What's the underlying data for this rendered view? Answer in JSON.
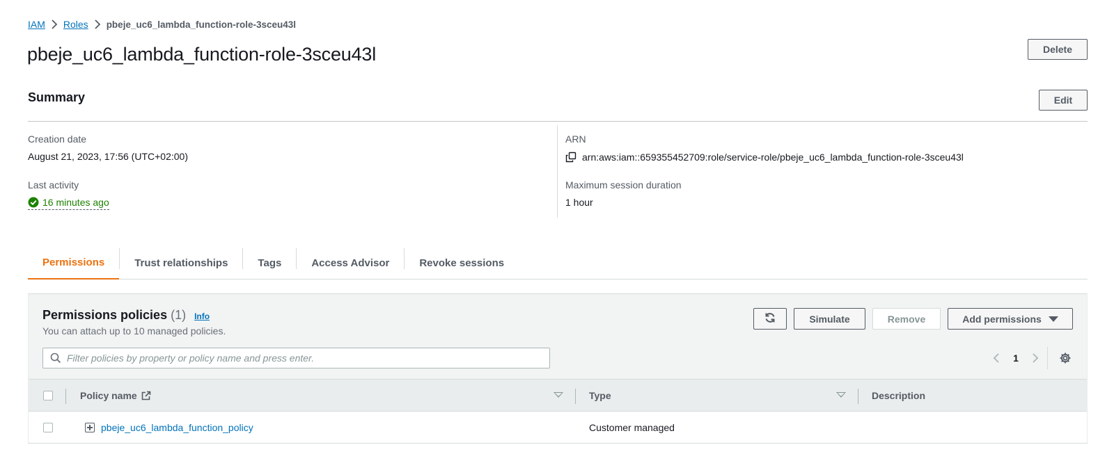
{
  "breadcrumb": {
    "items": [
      {
        "label": "IAM"
      },
      {
        "label": "Roles"
      }
    ],
    "current": "pbeje_uc6_lambda_function-role-3sceu43l"
  },
  "page": {
    "title": "pbeje_uc6_lambda_function-role-3sceu43l",
    "delete_label": "Delete"
  },
  "summary": {
    "title": "Summary",
    "edit_label": "Edit",
    "creation_date_label": "Creation date",
    "creation_date_value": "August 21, 2023, 17:56 (UTC+02:00)",
    "last_activity_label": "Last activity",
    "last_activity_value": "16 minutes ago",
    "arn_label": "ARN",
    "arn_value": "arn:aws:iam::659355452709:role/service-role/pbeje_uc6_lambda_function-role-3sceu43l",
    "max_session_label": "Maximum session duration",
    "max_session_value": "1 hour"
  },
  "tabs": [
    {
      "label": "Permissions",
      "active": true
    },
    {
      "label": "Trust relationships",
      "active": false
    },
    {
      "label": "Tags",
      "active": false
    },
    {
      "label": "Access Advisor",
      "active": false
    },
    {
      "label": "Revoke sessions",
      "active": false
    }
  ],
  "policies": {
    "title": "Permissions policies",
    "count": "(1)",
    "info_label": "Info",
    "subtitle": "You can attach up to 10 managed policies.",
    "simulate_label": "Simulate",
    "remove_label": "Remove",
    "add_permissions_label": "Add permissions",
    "filter_placeholder": "Filter policies by property or policy name and press enter.",
    "page_number": "1",
    "columns": [
      "Policy name",
      "Type",
      "Description"
    ],
    "rows": [
      {
        "name": "pbeje_uc6_lambda_function_policy",
        "type": "Customer managed",
        "description": ""
      }
    ]
  },
  "colors": {
    "link": "#0073bb",
    "accent_tab": "#ec7211",
    "success": "#1d8102"
  },
  "icons": [
    "chevron-right-icon",
    "check-circle-icon",
    "copy-icon",
    "refresh-icon",
    "caret-down-icon",
    "search-icon",
    "chevron-left-icon",
    "gear-icon",
    "external-link-icon",
    "sort-icon",
    "expand-icon"
  ]
}
